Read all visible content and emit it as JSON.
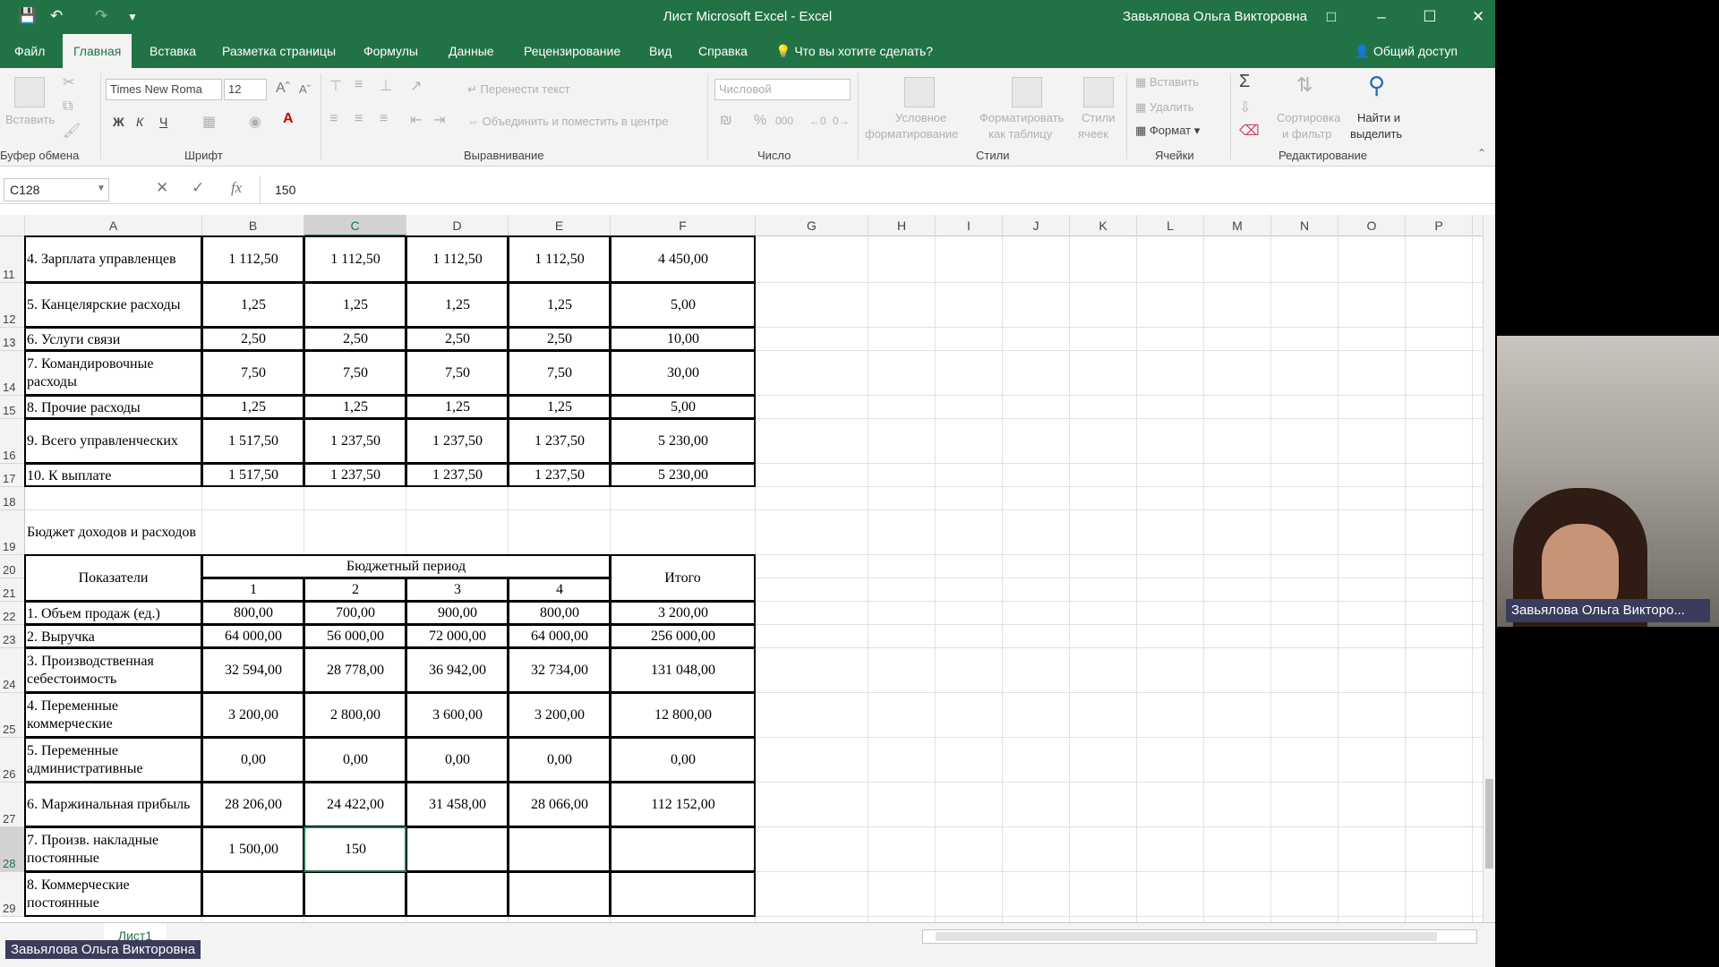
{
  "window": {
    "title": "Лист Microsoft Excel  -  Excel",
    "user": "Завьялова Ольга Викторовна"
  },
  "tabs": [
    "Файл",
    "Главная",
    "Вставка",
    "Разметка страницы",
    "Формулы",
    "Данные",
    "Рецензирование",
    "Вид",
    "Справка"
  ],
  "tell_me": "Что вы хотите сделать?",
  "share": "Общий доступ",
  "ribbon": {
    "paste": "Вставить",
    "clipboard": "Буфер обмена",
    "font_name": "Times New Roma",
    "font_size": "12",
    "font_group": "Шрифт",
    "bold": "Ж",
    "italic": "К",
    "underline": "Ч",
    "wrap_text": "Перенести текст",
    "merge_center": "Объединить и поместить в центре",
    "alignment_group": "Выравнивание",
    "number_format": "Числовой",
    "number_group": "Число",
    "conditional_fmt": "Условное",
    "conditional_fmt2": "форматирование",
    "format_table": "Форматировать",
    "format_table2": "как таблицу",
    "cell_styles": "Стили",
    "cell_styles2": "ячеек",
    "styles_group": "Стили",
    "insert": "Вставить",
    "delete": "Удалить",
    "format": "Формат",
    "cells_group": "Ячейки",
    "sort_filter": "Сортировка",
    "sort_filter2": "и фильтр",
    "find_select": "Найти и",
    "find_select2": "выделить",
    "editing_group": "Редактирование"
  },
  "formula_bar": {
    "name_box": "C128",
    "formula": "150",
    "fx": "fx"
  },
  "columns": [
    "A",
    "B",
    "C",
    "D",
    "E",
    "F",
    "G",
    "H",
    "I",
    "J",
    "K",
    "L",
    "M",
    "N",
    "O",
    "P"
  ],
  "rows": [
    {
      "n": "11",
      "a": "4. Зарплата управленцев",
      "b": "1 112,50",
      "c": "1 112,50",
      "d": "1 112,50",
      "e": "1 112,50",
      "f": "4 450,00"
    },
    {
      "n": "12",
      "a": "5. Канцелярские расходы",
      "b": "1,25",
      "c": "1,25",
      "d": "1,25",
      "e": "1,25",
      "f": "5,00"
    },
    {
      "n": "13",
      "a": "6. Услуги связи",
      "b": "2,50",
      "c": "2,50",
      "d": "2,50",
      "e": "2,50",
      "f": "10,00"
    },
    {
      "n": "14",
      "a": "7. Командировочные расходы",
      "b": "7,50",
      "c": "7,50",
      "d": "7,50",
      "e": "7,50",
      "f": "30,00"
    },
    {
      "n": "15",
      "a": "8. Прочие расходы",
      "b": "1,25",
      "c": "1,25",
      "d": "1,25",
      "e": "1,25",
      "f": "5,00"
    },
    {
      "n": "16",
      "a": "9. Всего управленческих",
      "b": "1 517,50",
      "c": "1 237,50",
      "d": "1 237,50",
      "e": "1 237,50",
      "f": "5 230,00"
    },
    {
      "n": "17",
      "a": "10. К выплате",
      "b": "1 517,50",
      "c": "1 237,50",
      "d": "1 237,50",
      "e": "1 237,50",
      "f": "5 230,00"
    },
    {
      "n": "18",
      "a": "",
      "b": "",
      "c": "",
      "d": "",
      "e": "",
      "f": ""
    },
    {
      "n": "19",
      "a": "Бюджет доходов и расходов",
      "b": "",
      "c": "",
      "d": "",
      "e": "",
      "f": ""
    },
    {
      "n": "20",
      "a": "",
      "b": "",
      "c": "",
      "d": "",
      "e": "",
      "f": ""
    },
    {
      "n": "21",
      "a": "",
      "b": "1",
      "c": "2",
      "d": "3",
      "e": "4",
      "f": ""
    },
    {
      "n": "22",
      "a": "1. Объем продаж (ед.)",
      "b": "800,00",
      "c": "700,00",
      "d": "900,00",
      "e": "800,00",
      "f": "3 200,00"
    },
    {
      "n": "23",
      "a": "2. Выручка",
      "b": "64 000,00",
      "c": "56 000,00",
      "d": "72 000,00",
      "e": "64 000,00",
      "f": "256 000,00"
    },
    {
      "n": "24",
      "a": "3. Производственная себестоимость",
      "b": "32 594,00",
      "c": "28 778,00",
      "d": "36 942,00",
      "e": "32 734,00",
      "f": "131 048,00"
    },
    {
      "n": "25",
      "a": "4. Переменные коммерческие",
      "b": "3 200,00",
      "c": "2 800,00",
      "d": "3 600,00",
      "e": "3 200,00",
      "f": "12 800,00"
    },
    {
      "n": "26",
      "a": "5. Переменные административные",
      "b": "0,00",
      "c": "0,00",
      "d": "0,00",
      "e": "0,00",
      "f": "0,00"
    },
    {
      "n": "27",
      "a": "6. Маржинальная прибыль",
      "b": "28 206,00",
      "c": "24 422,00",
      "d": "31 458,00",
      "e": "28 066,00",
      "f": "112 152,00"
    },
    {
      "n": "28",
      "a": "7. Произв. накладные постоянные",
      "b": "1 500,00",
      "c": "150",
      "d": "",
      "e": "",
      "f": ""
    },
    {
      "n": "29",
      "a": "8. Коммерческие постоянные",
      "b": "",
      "c": "",
      "d": "",
      "e": "",
      "f": ""
    }
  ],
  "header_block": {
    "indicators": "Показатели",
    "budget_period": "Бюджетный период",
    "total": "Итого"
  },
  "sheet_tab": "Лист1",
  "webcam": {
    "name": "Завьялова Ольга Викторо..."
  },
  "presenter_label": "Завьялова Ольга Викторовна"
}
